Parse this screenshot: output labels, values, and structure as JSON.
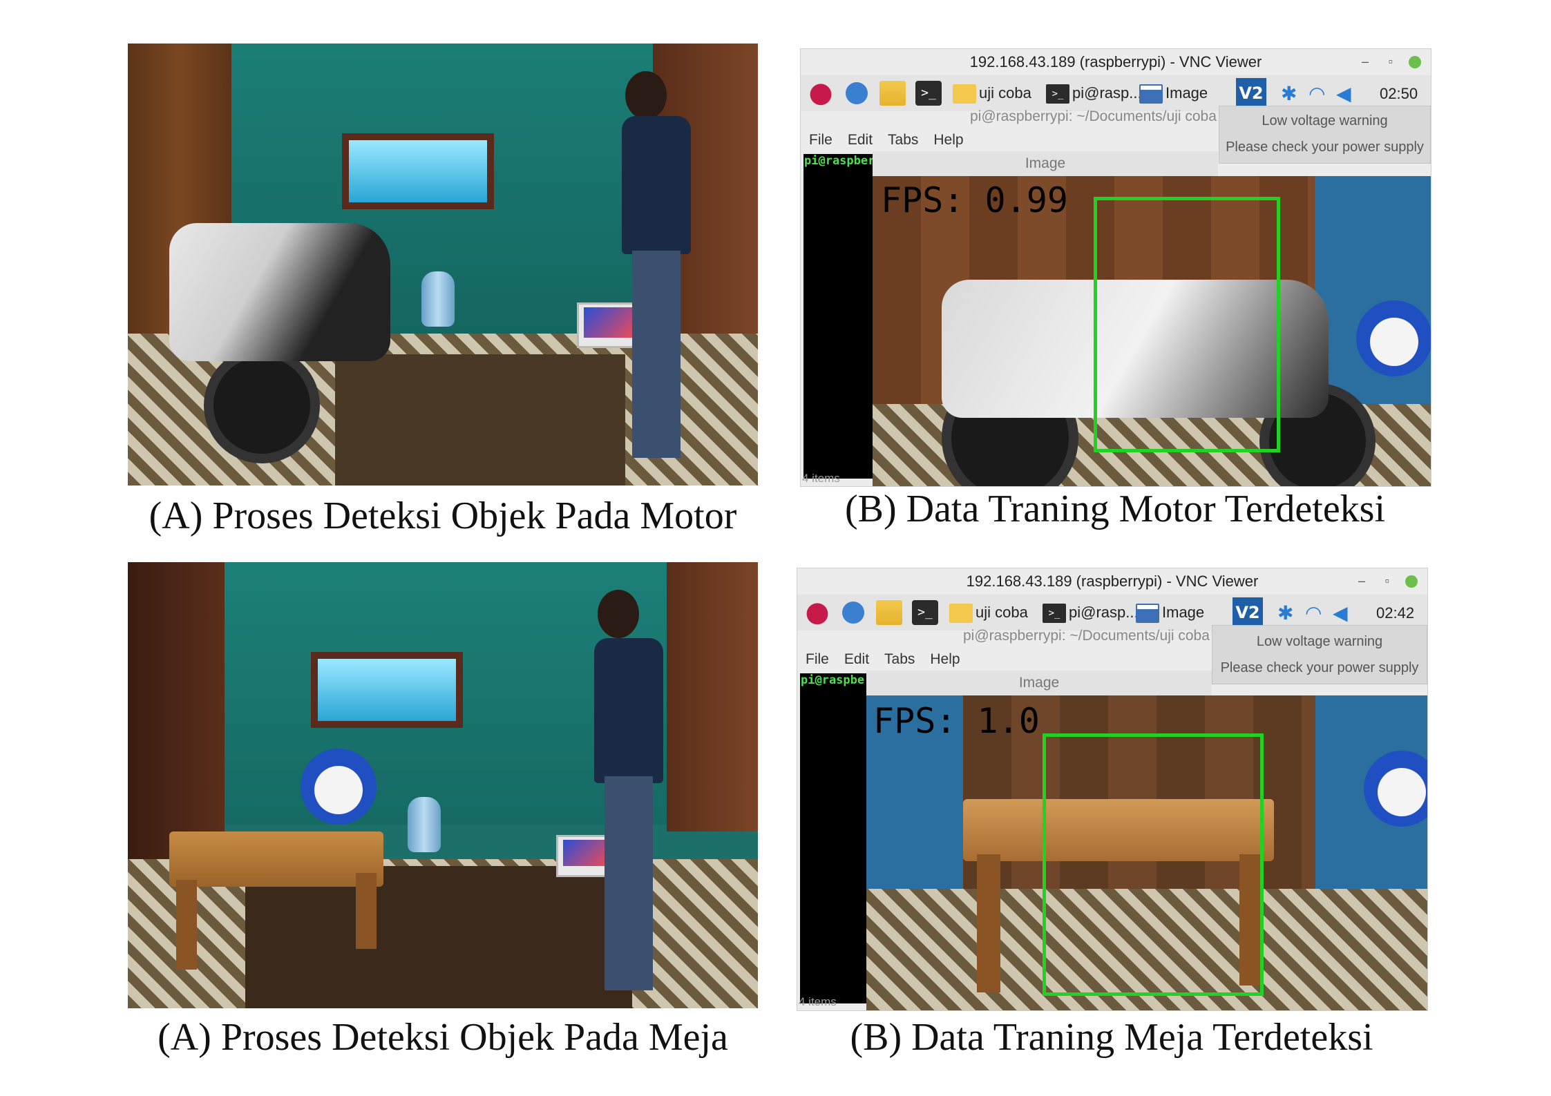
{
  "captions": {
    "top_left": "(A) Proses Deteksi Objek Pada Motor",
    "top_right": "(B) Data Traning Motor Terdeteksi",
    "bottom_left": "(A) Proses Deteksi Objek Pada Meja",
    "bottom_right": "(B) Data Traning Meja Terdeteksi"
  },
  "vnc_motor": {
    "window_title": "192.168.43.189 (raspberrypi) - VNC Viewer",
    "taskbar": {
      "folder_task": "uji coba",
      "terminal_task": "pi@rasp...",
      "image_task": "Image",
      "vnc_icon": "V2",
      "clock": "02:50"
    },
    "terminal_title": "pi@raspberrypi: ~/Documents/uji coba",
    "menu": [
      "File",
      "Edit",
      "Tabs",
      "Help"
    ],
    "prompt": "pi@raspber",
    "items_status": "4 items",
    "notification": {
      "title": "Low voltage warning",
      "message": "Please check your power supply"
    },
    "image_window_title": "Image",
    "fps": "FPS: 0.99"
  },
  "vnc_table": {
    "window_title": "192.168.43.189 (raspberrypi) - VNC Viewer",
    "taskbar": {
      "folder_task": "uji coba",
      "terminal_task": "pi@rasp...",
      "image_task": "Image",
      "vnc_icon": "V2",
      "clock": "02:42"
    },
    "terminal_title": "pi@raspberrypi: ~/Documents/uji coba",
    "menu": [
      "File",
      "Edit",
      "Tabs",
      "Help"
    ],
    "prompt": "pi@raspbe",
    "items_status": "4 items",
    "notification": {
      "title": "Low voltage warning",
      "message": "Please check your power supply"
    },
    "image_window_title": "Image",
    "fps": "FPS: 1.0"
  },
  "colors": {
    "bbox": "#22d122",
    "prompt": "#4de04d"
  }
}
